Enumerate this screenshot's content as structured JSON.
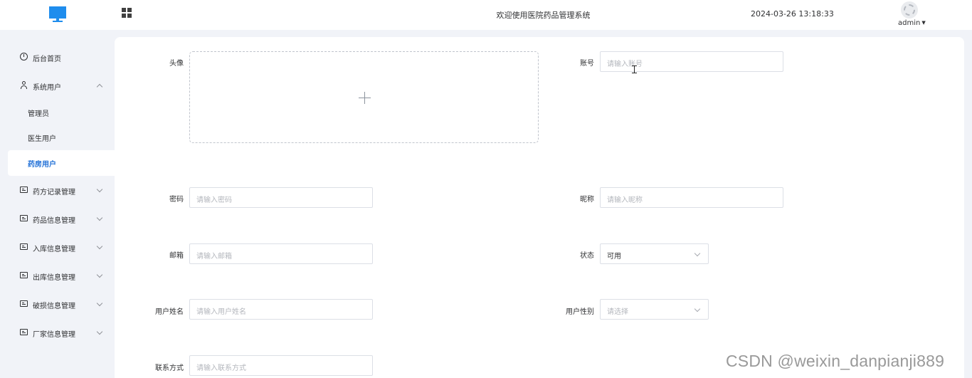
{
  "header": {
    "title": "欢迎使用医院药品管理系统",
    "datetime": "2024-03-26 13:18:33",
    "user": "admin",
    "icons": {
      "logo": "monitor-logo",
      "menu_toggle": "grid-icon",
      "avatar": "avatar-placeholder"
    }
  },
  "sidebar": {
    "items": [
      {
        "label": "后台首页",
        "icon": "clock-icon"
      },
      {
        "label": "系统用户",
        "icon": "user-icon",
        "expanded": true,
        "children": [
          {
            "label": "管理员"
          },
          {
            "label": "医生用户"
          },
          {
            "label": "药房用户",
            "active": true
          }
        ]
      },
      {
        "label": "药方记录管理",
        "icon": "card-icon"
      },
      {
        "label": "药品信息管理",
        "icon": "card-icon"
      },
      {
        "label": "入库信息管理",
        "icon": "card-icon"
      },
      {
        "label": "出库信息管理",
        "icon": "card-icon"
      },
      {
        "label": "破损信息管理",
        "icon": "card-icon"
      },
      {
        "label": "厂家信息管理",
        "icon": "card-icon"
      }
    ]
  },
  "form": {
    "avatar": {
      "label": "头像"
    },
    "account": {
      "label": "账号",
      "placeholder": "请输入账号"
    },
    "password": {
      "label": "密码",
      "placeholder": "请输入密码"
    },
    "nickname": {
      "label": "昵称",
      "placeholder": "请输入昵称"
    },
    "email": {
      "label": "邮箱",
      "placeholder": "请输入邮箱"
    },
    "status": {
      "label": "状态",
      "value": "可用"
    },
    "real_name": {
      "label": "用户姓名",
      "placeholder": "请输入用户姓名"
    },
    "gender": {
      "label": "用户性别",
      "placeholder": "请选择"
    },
    "phone": {
      "label": "联系方式",
      "placeholder": "请输入联系方式"
    }
  },
  "watermark": "CSDN @weixin_danpianji889",
  "colors": {
    "accent": "#1f6fd6",
    "logo": "#1f8ded",
    "sidebar_bg": "#f1f3f8"
  }
}
